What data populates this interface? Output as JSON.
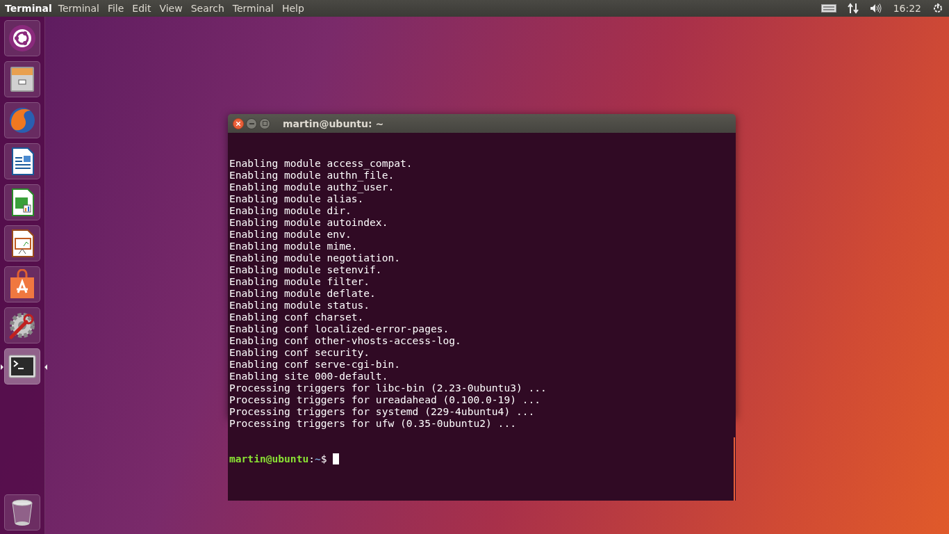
{
  "top_bar": {
    "app_name": "Terminal",
    "menus": [
      "Terminal",
      "File",
      "Edit",
      "View",
      "Search",
      "Terminal",
      "Help"
    ],
    "time": "16:22"
  },
  "launcher": {
    "items": [
      {
        "kind": "dash",
        "selected": false
      },
      {
        "kind": "files",
        "selected": false
      },
      {
        "kind": "browser",
        "selected": false
      },
      {
        "kind": "writer",
        "selected": false
      },
      {
        "kind": "calc",
        "selected": false
      },
      {
        "kind": "impress",
        "selected": false
      },
      {
        "kind": "store",
        "selected": false
      },
      {
        "kind": "settings",
        "selected": false
      },
      {
        "kind": "terminal",
        "selected": true
      }
    ],
    "trash": {
      "kind": "trash",
      "selected": false
    }
  },
  "terminal_window": {
    "title": "martin@ubuntu: ~",
    "lines": [
      "Enabling module access_compat.",
      "Enabling module authn_file.",
      "Enabling module authz_user.",
      "Enabling module alias.",
      "Enabling module dir.",
      "Enabling module autoindex.",
      "Enabling module env.",
      "Enabling module mime.",
      "Enabling module negotiation.",
      "Enabling module setenvif.",
      "Enabling module filter.",
      "Enabling module deflate.",
      "Enabling module status.",
      "Enabling conf charset.",
      "Enabling conf localized-error-pages.",
      "Enabling conf other-vhosts-access-log.",
      "Enabling conf security.",
      "Enabling conf serve-cgi-bin.",
      "Enabling site 000-default.",
      "Processing triggers for libc-bin (2.23-0ubuntu3) ...",
      "Processing triggers for ureadahead (0.100.0-19) ...",
      "Processing triggers for systemd (229-4ubuntu4) ...",
      "Processing triggers for ufw (0.35-0ubuntu2) ..."
    ],
    "prompt": {
      "user_host": "martin@ubuntu",
      "separator": ":",
      "path": "~",
      "symbol": "$"
    }
  }
}
